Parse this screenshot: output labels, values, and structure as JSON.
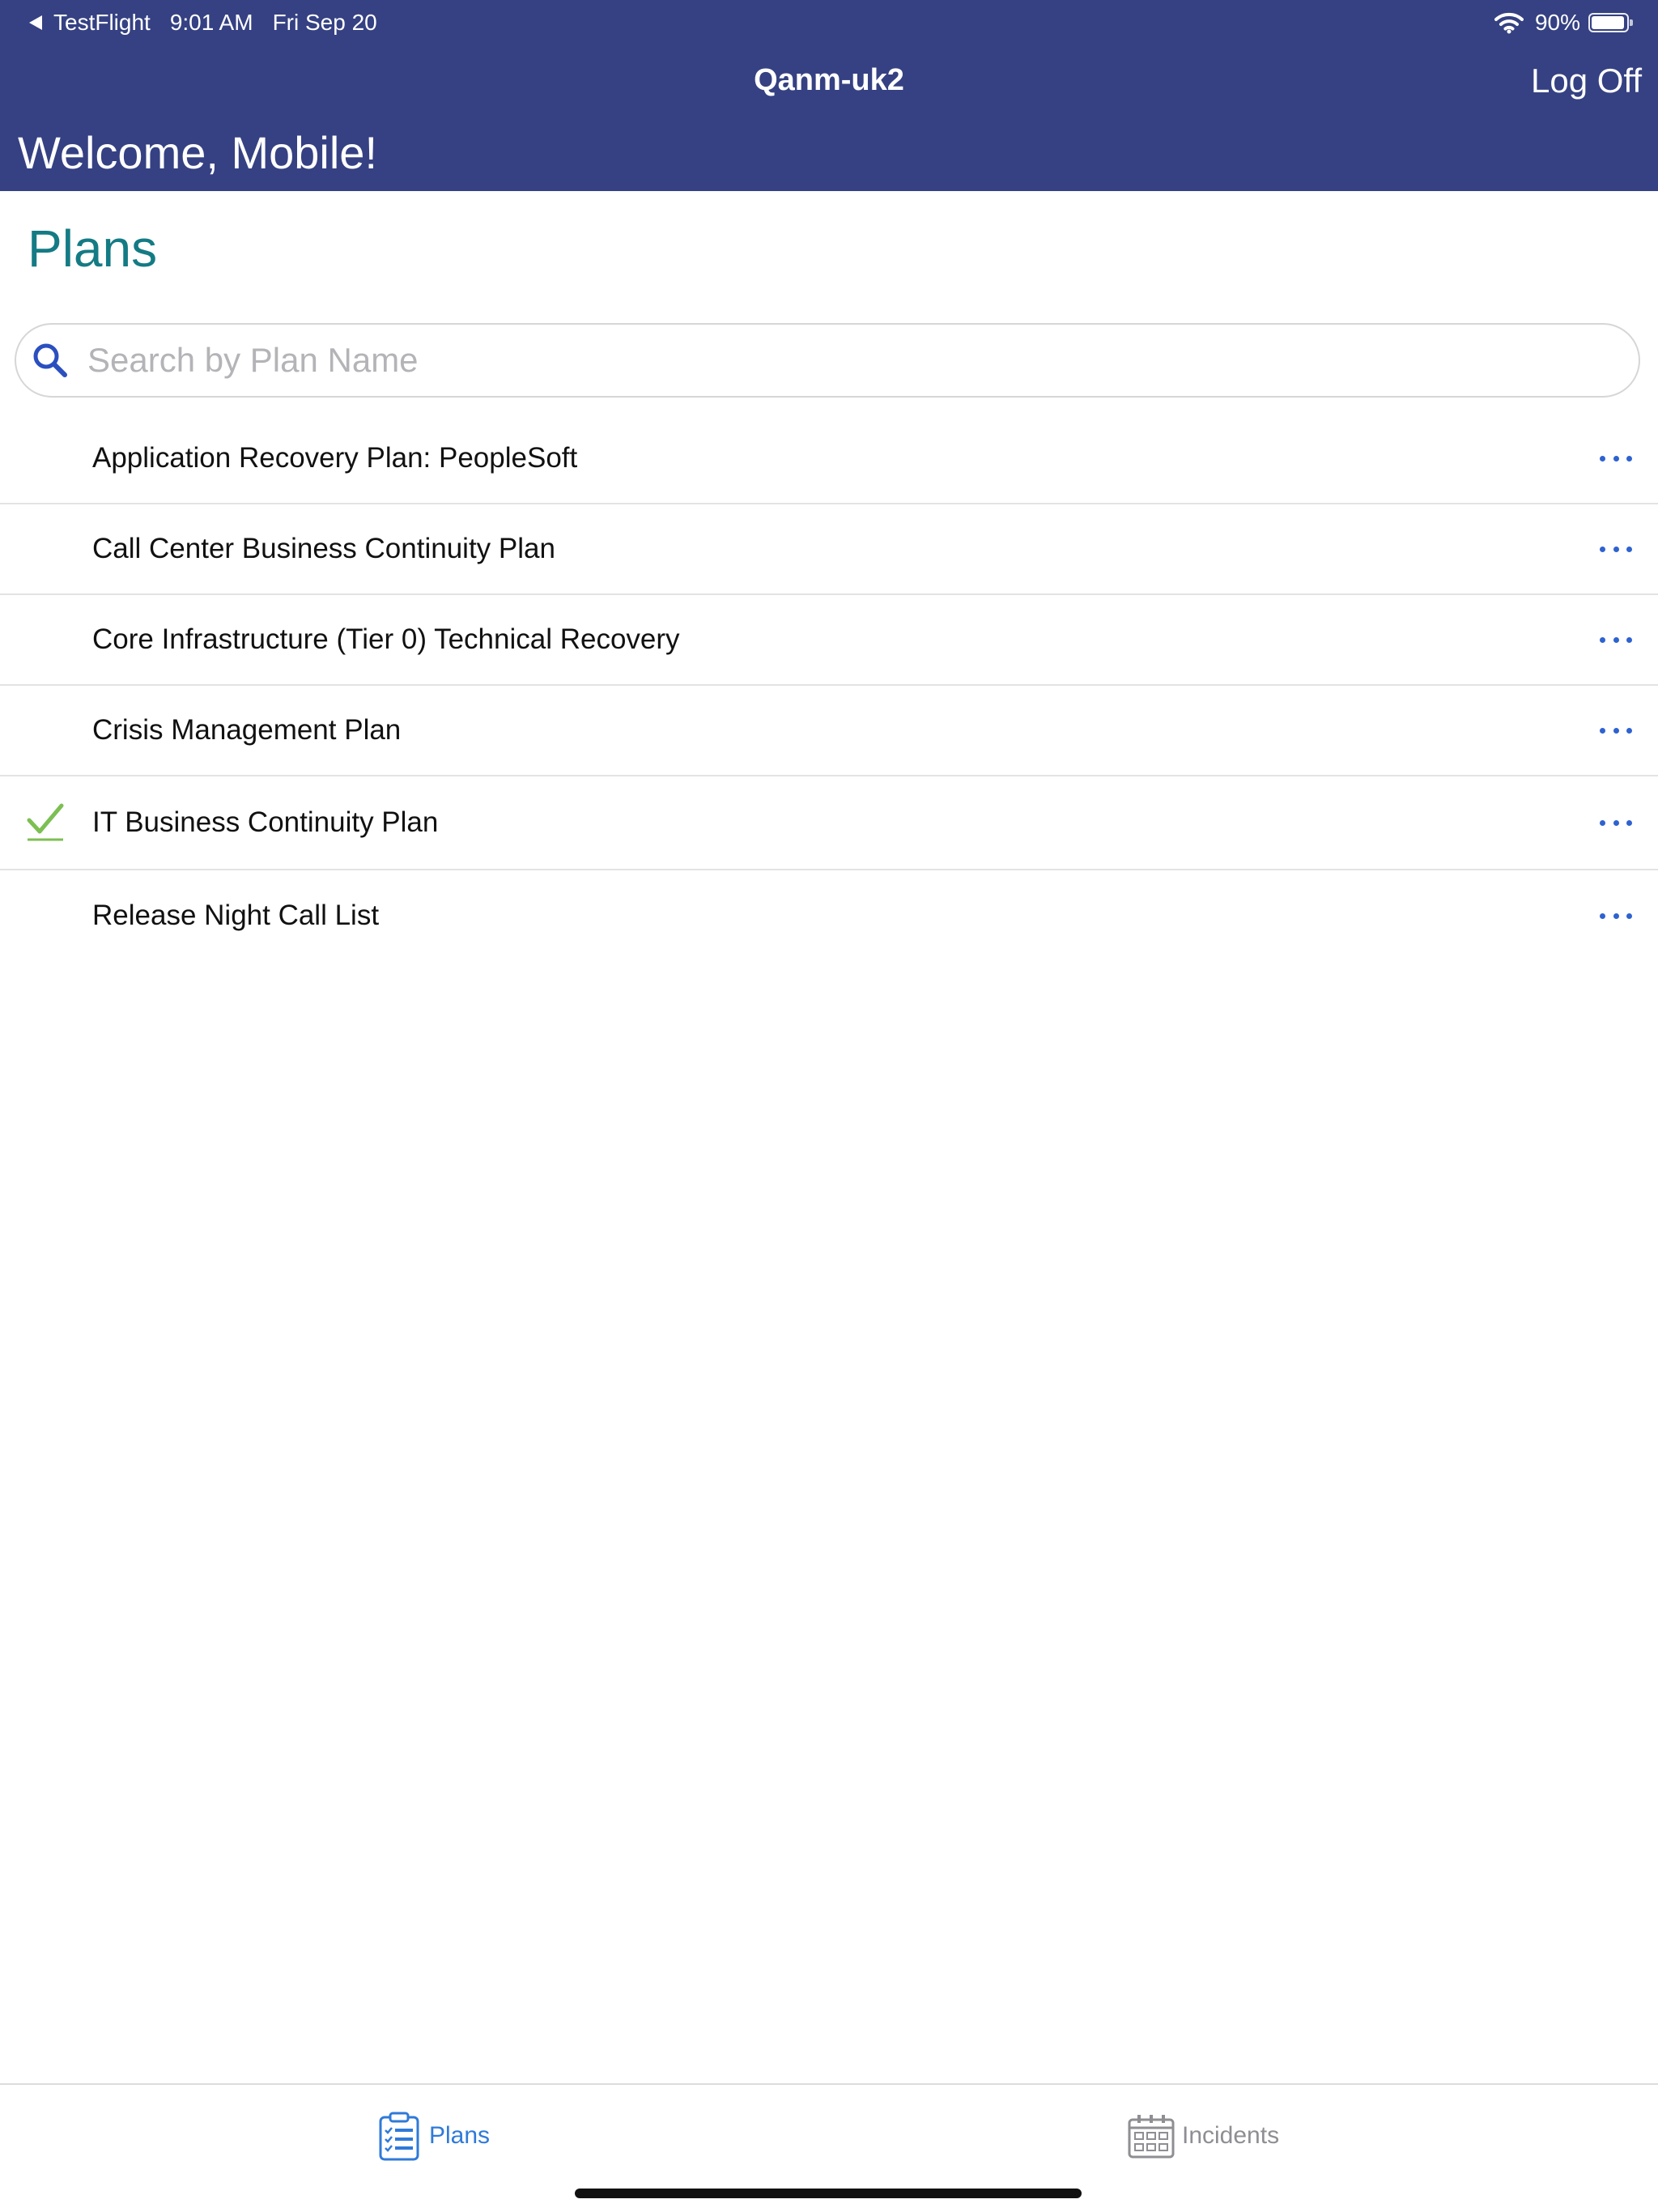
{
  "status_bar": {
    "back_app": "TestFlight",
    "time": "9:01 AM",
    "date": "Fri Sep 20",
    "battery": "90%",
    "battery_level": 0.9
  },
  "header": {
    "title": "Qanm-uk2",
    "logoff_label": "Log Off",
    "welcome": "Welcome, Mobile!",
    "bg_color": "#354182"
  },
  "main": {
    "title": "Plans",
    "search_placeholder": "Search by Plan Name",
    "search_value": ""
  },
  "plans": [
    {
      "name": "Application Recovery Plan: PeopleSoft",
      "selected": false
    },
    {
      "name": "Call Center Business Continuity Plan",
      "selected": false
    },
    {
      "name": "Core Infrastructure (Tier 0) Technical Recovery",
      "selected": false
    },
    {
      "name": "Crisis Management Plan",
      "selected": false
    },
    {
      "name": "IT Business Continuity Plan",
      "selected": true
    },
    {
      "name": "Release Night Call List",
      "selected": false
    }
  ],
  "tabbar": {
    "tabs": [
      {
        "label": "Plans",
        "icon": "clipboard-list-icon",
        "active": true
      },
      {
        "label": "Incidents",
        "icon": "calendar-grid-icon",
        "active": false
      }
    ]
  },
  "colors": {
    "accent": "#2f7ad8",
    "title_teal": "#147b84",
    "check_green": "#7cbf52",
    "more_blue": "#2e62d0"
  }
}
